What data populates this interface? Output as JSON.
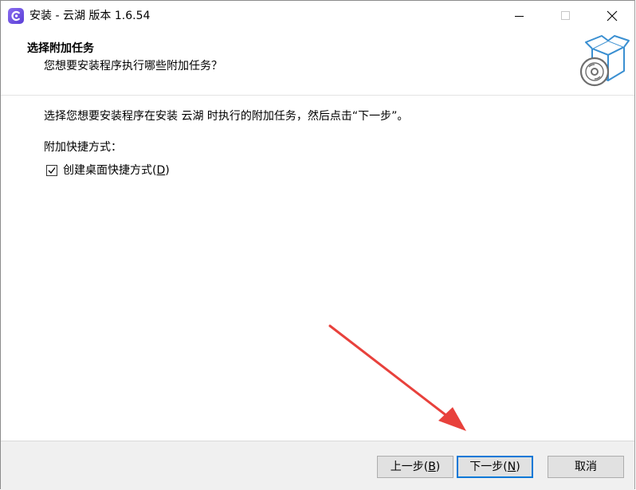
{
  "window": {
    "title": "安装 - 云湖 版本 1.6.54",
    "icon": "yunhu-app-icon",
    "controls": {
      "minimize_icon": "minimize-icon",
      "maximize_icon": "maximize-icon",
      "close_icon": "close-icon"
    }
  },
  "header": {
    "title": "选择附加任务",
    "subtitle": "您想要安装程序执行哪些附加任务？",
    "image_icon": "setup-box-disc-icon"
  },
  "content": {
    "description": "选择您想要安装程序在安装 云湖 时执行的附加任务，然后点击“下一步”。",
    "group_label": "附加快捷方式：",
    "tasks": [
      {
        "label_prefix": "创建桌面快捷方式(",
        "accel": "D",
        "label_suffix": ")",
        "checked": true
      }
    ]
  },
  "footer": {
    "back": {
      "prefix": "上一步(",
      "accel": "B",
      "suffix": ")"
    },
    "next": {
      "prefix": "下一步(",
      "accel": "N",
      "suffix": ")"
    },
    "cancel": "取消"
  },
  "annotation": {
    "icon": "red-arrow-annotation",
    "color": "#e8413c"
  },
  "colors": {
    "focus_border": "#0078d7",
    "footer_bg": "#f0f0f0",
    "button_bg": "#e1e1e1"
  }
}
